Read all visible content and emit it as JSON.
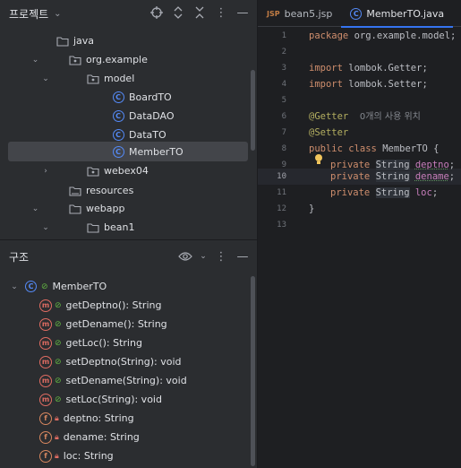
{
  "project_panel": {
    "title": "프로젝트",
    "tree": [
      {
        "label": "java",
        "icon": "folder-icon",
        "expanded": true
      },
      {
        "label": "org.example",
        "icon": "package-icon",
        "expanded": true
      },
      {
        "label": "model",
        "icon": "package-icon",
        "expanded": true
      },
      {
        "label": "BoardTO",
        "icon": "class-icon"
      },
      {
        "label": "DataDAO",
        "icon": "class-icon"
      },
      {
        "label": "DataTO",
        "icon": "class-icon"
      },
      {
        "label": "MemberTO",
        "icon": "class-icon",
        "selected": true
      },
      {
        "label": "webex04",
        "icon": "package-icon",
        "expanded": false
      },
      {
        "label": "resources",
        "icon": "folder-icon"
      },
      {
        "label": "webapp",
        "icon": "folder-icon",
        "expanded": true
      },
      {
        "label": "bean1",
        "icon": "folder-icon",
        "expanded": true
      }
    ]
  },
  "structure_panel": {
    "title": "구조",
    "root": "MemberTO",
    "members": [
      {
        "label": "getDeptno(): String",
        "kind": "method"
      },
      {
        "label": "getDename(): String",
        "kind": "method"
      },
      {
        "label": "getLoc(): String",
        "kind": "method"
      },
      {
        "label": "setDeptno(String): void",
        "kind": "method"
      },
      {
        "label": "setDename(String): void",
        "kind": "method"
      },
      {
        "label": "setLoc(String): void",
        "kind": "method"
      },
      {
        "label": "deptno: String",
        "kind": "field"
      },
      {
        "label": "dename: String",
        "kind": "field"
      },
      {
        "label": "loc: String",
        "kind": "field"
      }
    ]
  },
  "editor": {
    "tabs": [
      {
        "label": "bean5.jsp",
        "badge": "JSP",
        "active": false
      },
      {
        "label": "MemberTO.java",
        "badge": "C",
        "active": true
      }
    ],
    "line_numbers": [
      "1",
      "2",
      "3",
      "4",
      "5",
      "6",
      "7",
      "8",
      "9",
      "10",
      "11",
      "12",
      "13"
    ],
    "current_line": "10",
    "code": {
      "l1_kw": "package",
      "l1_rest": " org.example.model;",
      "l3_kw": "import",
      "l3_rest": " lombok.Getter;",
      "l4_kw": "import",
      "l4_rest": " lombok.Setter;",
      "l6_ann": "@Getter",
      "l6_hint": "0개의 사용 위치",
      "l7_ann": "@Setter",
      "l8_kw1": "public",
      "l8_kw2": "class",
      "l8_name": "MemberTO {",
      "l9_kw": "private",
      "l9_type": "String",
      "l9_field": "deptno",
      "l9_end": ";",
      "l10_kw": "private",
      "l10_type": "String",
      "l10_field": "dename",
      "l10_end": ";",
      "l11_kw": "private",
      "l11_type": "String",
      "l11_field": "loc",
      "l11_end": ";",
      "l12": "}"
    }
  },
  "colors": {
    "selection": "#43454a",
    "accent": "#3574f0",
    "class_icon": "#548af7",
    "method_icon": "#e06c62"
  }
}
